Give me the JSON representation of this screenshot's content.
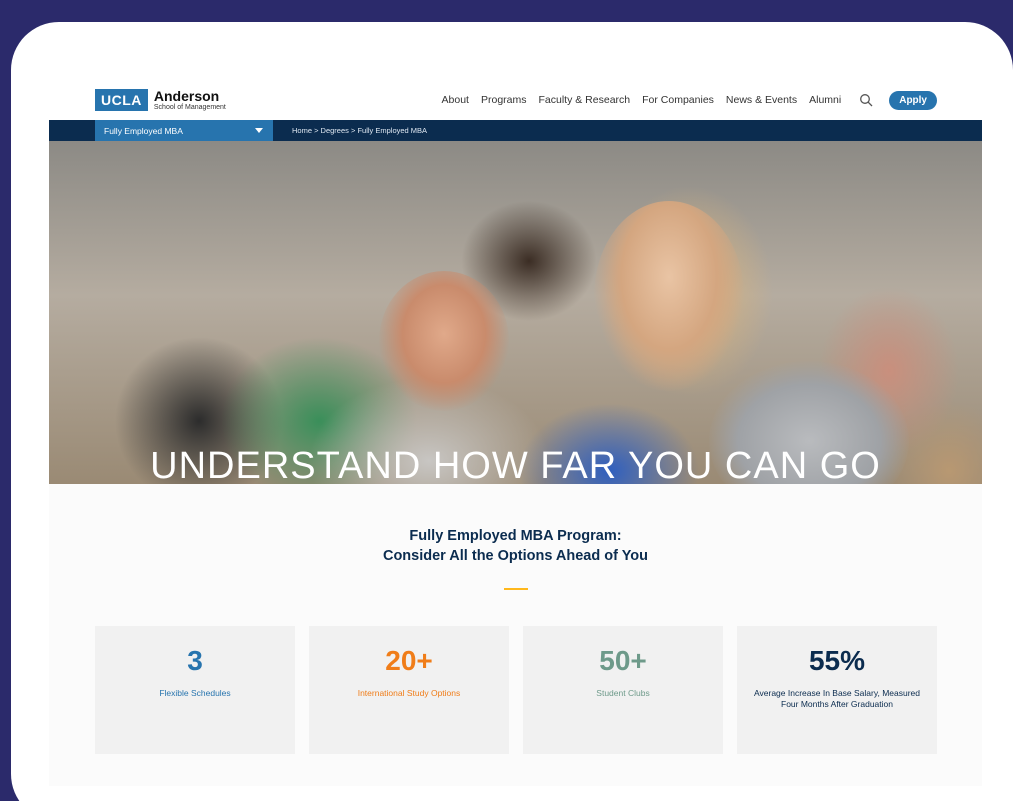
{
  "colors": {
    "background": "#2b2a6b",
    "ucla_blue": "#2774ae",
    "navy": "#0b2c4f",
    "gold": "#ffb81c",
    "orange": "#f07d19",
    "sage": "#6e9a8a",
    "accent_pink": "#e33d6c"
  },
  "header": {
    "logo_ucla": "UCLA",
    "logo_anderson": "Anderson",
    "logo_school": "School of Management",
    "nav": [
      "About",
      "Programs",
      "Faculty & Research",
      "For Companies",
      "News & Events",
      "Alumni"
    ],
    "search_icon": "search-icon",
    "apply_label": "Apply"
  },
  "subnav": {
    "program_select": "Fully Employed MBA",
    "breadcrumb": "Home > Degrees > Fully Employed MBA"
  },
  "hero": {
    "title": "UNDERSTAND HOW FAR YOU CAN GO"
  },
  "intro": {
    "line1": "Fully Employed MBA Program:",
    "line2": "Consider All the Options Ahead of You"
  },
  "stats": [
    {
      "value": "3",
      "label": "Flexible Schedules",
      "color": "#2774ae"
    },
    {
      "value": "20+",
      "label": "International Study Options",
      "color": "#f07d19"
    },
    {
      "value": "50+",
      "label": "Student Clubs",
      "color": "#6e9a8a"
    },
    {
      "value": "55%",
      "label": "Average Increase In Base Salary, Measured Four Months After Graduation",
      "color": "#0b2c4f"
    }
  ]
}
